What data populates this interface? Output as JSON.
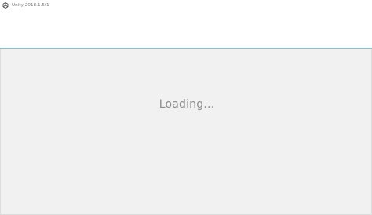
{
  "window": {
    "title": "Unity 2018.1.5f1",
    "icon": "unity-logo-icon"
  },
  "content": {
    "loading_text": "Loading..."
  },
  "colors": {
    "accent_line": "#7fc4d8",
    "content_background": "#f1f1f1",
    "loading_text": "#8c8c8c"
  }
}
